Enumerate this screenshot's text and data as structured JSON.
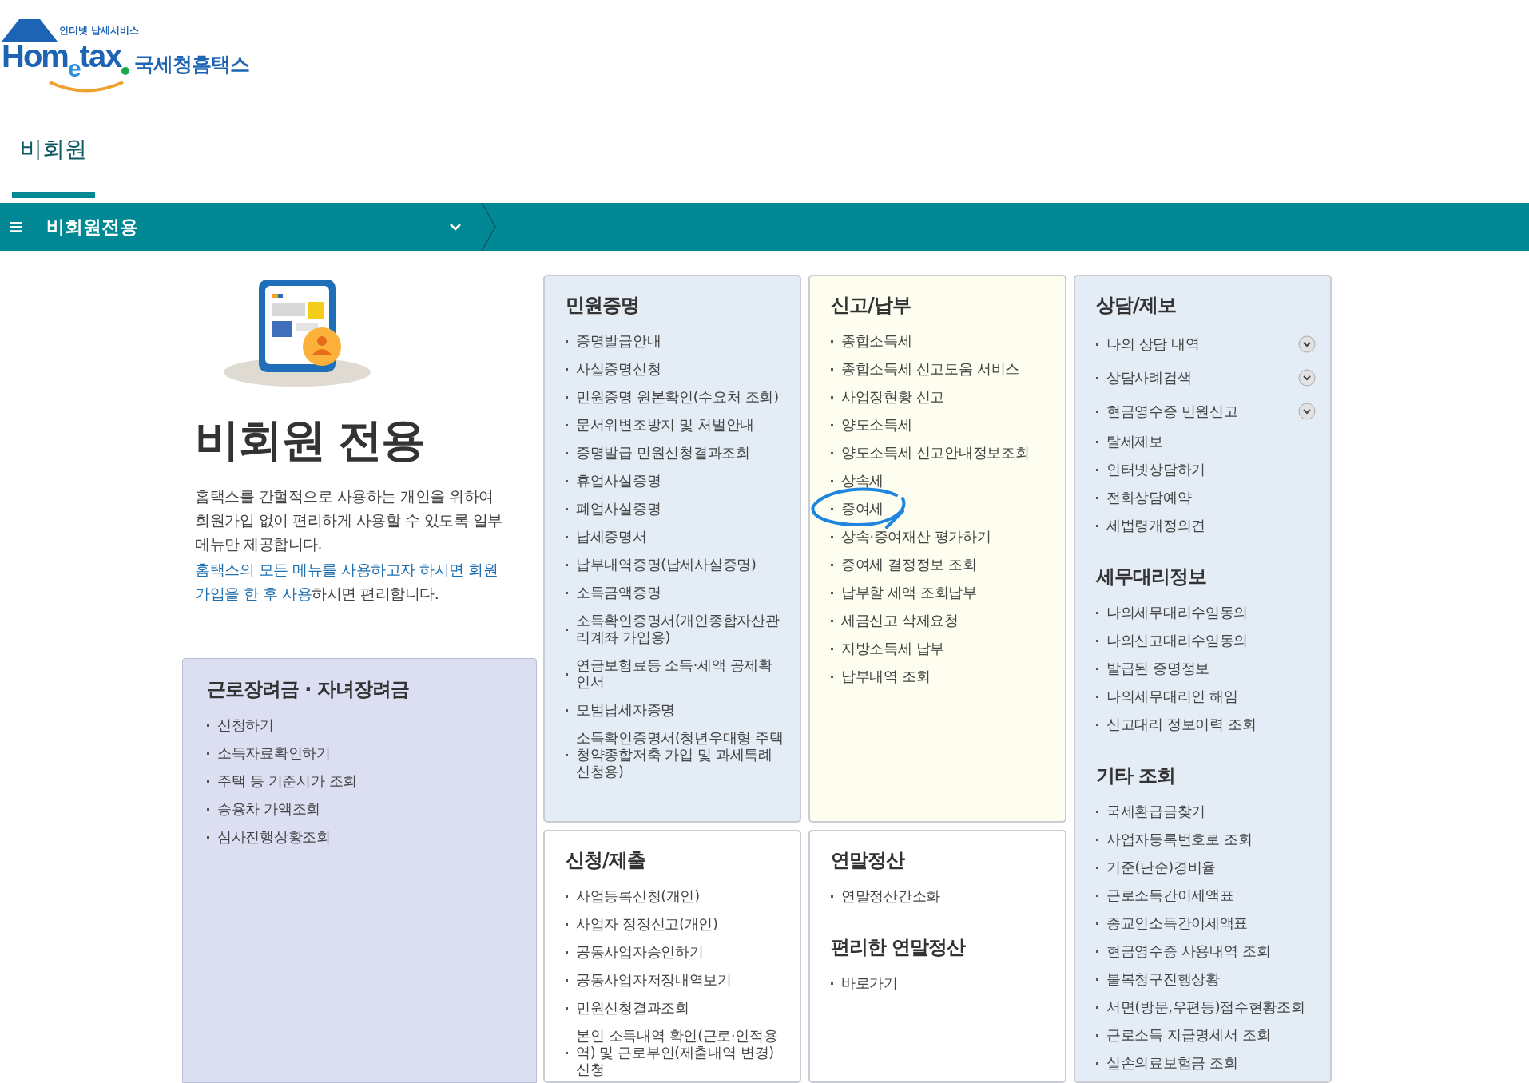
{
  "logo": {
    "tagline": "인터넷 납세서비스",
    "wordmark_left": "Hom",
    "wordmark_e": "e",
    "wordmark_right": "tax",
    "site_name": "국세청홈택스"
  },
  "tabs": [
    {
      "label": "비회원",
      "selected": true
    }
  ],
  "menu_bar": {
    "menu_glyph": "≡",
    "title": "비회원전용"
  },
  "intro": {
    "heading": "비회원 전용",
    "paragraphs": [
      "홈택스를 간헐적으로 사용하는 개인을 위하여 회원가입 없이 편리하게 사용할 수 있도록 일부메뉴만 제공합니다.",
      "**홈택스의 모든 메뉴를 사용하고자 하시면 회원가입을 한 후 사용**하시면 편리합니다."
    ]
  },
  "side_panel": {
    "title": "근로장려금 · 자녀장려금",
    "items": [
      "신청하기",
      "소득자료확인하기",
      "주택 등 기준시가 조회",
      "승용차 가액조회",
      "심사진행상황조회"
    ]
  },
  "columns": [
    {
      "panels": [
        {
          "color": "#e4ecf5",
          "sections": [
            {
              "title": "민원증명",
              "items": [
                {
                  "label": "증명발급안내"
                },
                {
                  "label": "사실증명신청"
                },
                {
                  "label": "민원증명 원본확인(수요처 조회)"
                },
                {
                  "label": "문서위변조방지 및 처벌안내"
                },
                {
                  "label": "증명발급 민원신청결과조회"
                },
                {
                  "label": "휴업사실증명"
                },
                {
                  "label": "폐업사실증명"
                },
                {
                  "label": "납세증명서"
                },
                {
                  "label": "납부내역증명(납세사실증명)"
                },
                {
                  "label": "소득금액증명"
                },
                {
                  "label": "소득확인증명서(개인종합자산관리계좌 가입용)"
                },
                {
                  "label": "연금보험료등 소득·세액 공제확인서"
                },
                {
                  "label": "모범납세자증명"
                },
                {
                  "label": "소득확인증명서(청년우대형 주택청약종합저축 가입 및 과세특례 신청용)"
                }
              ]
            }
          ]
        },
        {
          "color": "#ffffff",
          "sections": [
            {
              "title": "신청/제출",
              "items": [
                {
                  "label": "사업등록신청(개인)"
                },
                {
                  "label": "사업자 정정신고(개인)"
                },
                {
                  "label": "공동사업자승인하기"
                },
                {
                  "label": "공동사업자저장내역보기"
                },
                {
                  "label": "민원신청결과조회"
                },
                {
                  "label": "본인 소득내역 확인(근로·인적용역) 및 근로부인(제출내역 변경) 신청"
                }
              ]
            }
          ]
        }
      ]
    },
    {
      "panels": [
        {
          "color": "#fdfdf0",
          "sections": [
            {
              "title": "신고/납부",
              "items": [
                {
                  "label": "종합소득세"
                },
                {
                  "label": "종합소득세 신고도움 서비스"
                },
                {
                  "label": "사업장현황 신고"
                },
                {
                  "label": "양도소득세"
                },
                {
                  "label": "양도소득세 신고안내정보조회"
                },
                {
                  "label": "상속세"
                },
                {
                  "label": "증여세",
                  "circled": true
                },
                {
                  "label": "상속·증여재산 평가하기"
                },
                {
                  "label": "증여세 결정정보 조회"
                },
                {
                  "label": "납부할 세액 조회납부"
                },
                {
                  "label": "세금신고 삭제요청"
                },
                {
                  "label": "지방소득세 납부"
                },
                {
                  "label": "납부내역 조회"
                }
              ]
            }
          ]
        },
        {
          "color": "#ffffff",
          "sections": [
            {
              "title": "연말정산",
              "items": [
                {
                  "label": "연말정산간소화"
                }
              ]
            },
            {
              "title": "편리한 연말정산",
              "items": [
                {
                  "label": "바로가기"
                }
              ]
            }
          ]
        }
      ]
    },
    {
      "panels": [
        {
          "color": "#e4ecf5",
          "sections": [
            {
              "title": "상담/제보",
              "items": [
                {
                  "label": "나의 상담 내역",
                  "expandable": true
                },
                {
                  "label": "상담사례검색",
                  "expandable": true
                },
                {
                  "label": "현금영수증 민원신고",
                  "expandable": true
                },
                {
                  "label": "탈세제보"
                },
                {
                  "label": "인터넷상담하기"
                },
                {
                  "label": "전화상담예약"
                },
                {
                  "label": "세법령개정의견"
                }
              ]
            },
            {
              "title": "세무대리정보",
              "items": [
                {
                  "label": "나의세무대리수임동의"
                },
                {
                  "label": "나의신고대리수임동의"
                },
                {
                  "label": "발급된 증명정보"
                },
                {
                  "label": "나의세무대리인 해임"
                },
                {
                  "label": "신고대리 정보이력 조회"
                }
              ]
            },
            {
              "title": "기타 조회",
              "items": [
                {
                  "label": "국세환급금찾기"
                },
                {
                  "label": "사업자등록번호로 조회"
                },
                {
                  "label": "기준(단순)경비율"
                },
                {
                  "label": "근로소득간이세액표"
                },
                {
                  "label": "종교인소득간이세액표"
                },
                {
                  "label": "현금영수증 사용내역 조회"
                },
                {
                  "label": "불복청구진행상황"
                },
                {
                  "label": "서면(방문,우편등)접수현황조회"
                },
                {
                  "label": "근로소득 지급명세서 조회"
                },
                {
                  "label": "실손의료보험금 조회"
                }
              ]
            }
          ]
        }
      ]
    }
  ]
}
